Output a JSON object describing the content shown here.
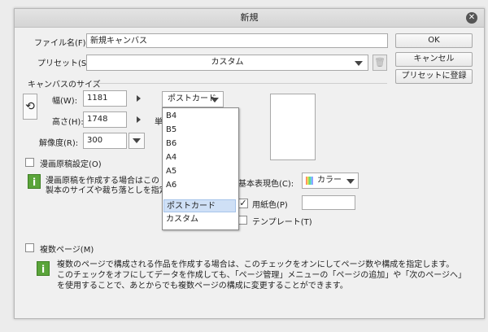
{
  "window": {
    "title": "新規"
  },
  "buttons": {
    "ok": "OK",
    "cancel": "キャンセル",
    "register_preset": "プリセットに登録"
  },
  "file_name": {
    "label": "ファイル名(F):",
    "value": "新規キャンバス"
  },
  "preset": {
    "label": "プリセット(S):",
    "value": "カスタム"
  },
  "canvas_size": {
    "group_label": "キャンバスのサイズ",
    "width_label": "幅(W):",
    "width_value": "1181",
    "height_label": "高さ(H):",
    "height_value": "1748",
    "unit_label": "単",
    "resolution_label": "解像度(R):",
    "resolution_value": "300",
    "paper_select": "ポストカード",
    "paper_options": [
      "B4",
      "B5",
      "B6",
      "A4",
      "A5",
      "A6",
      "ポストカード",
      "カスタム"
    ],
    "selected_option": "ポストカード"
  },
  "manga": {
    "checkbox_label": "漫画原稿設定(O)",
    "info_line1": "漫画原稿を作成する場合はこの",
    "info_line2": "製本のサイズや裁ち落としを指定"
  },
  "color": {
    "label": "基本表現色(C):",
    "value": "カラー",
    "paper_color_label": "用紙色(P)",
    "paper_color_checked": true,
    "paper_color": "#ffffff",
    "template_label": "テンプレート(T)",
    "template_checked": false
  },
  "multipage": {
    "checkbox_label": "複数ページ(M)",
    "info_line1": "複数のページで構成される作品を作成する場合は、このチェックをオンにしてページ数や構成を指定します。",
    "info_line2": "このチェックをオフにしてデータを作成しても、「ページ管理」メニューの「ページの追加」や「次のページへ」",
    "info_line3": "を使用することで、あとからでも複数ページの構成に変更することができます。"
  }
}
